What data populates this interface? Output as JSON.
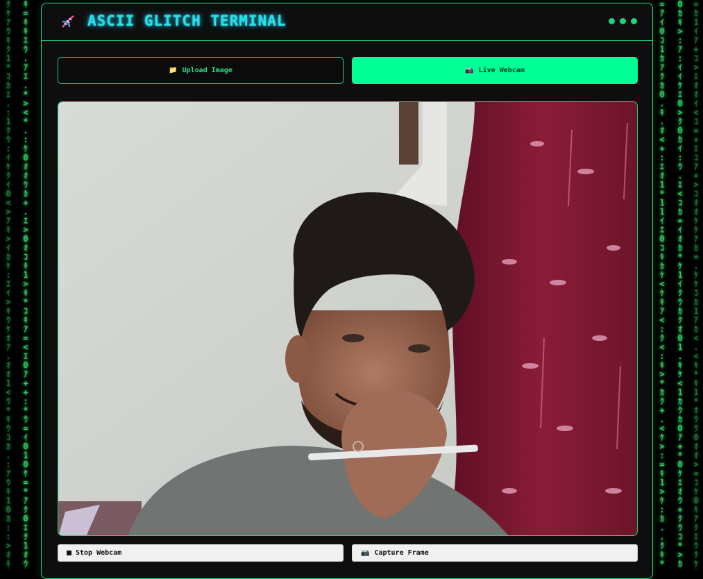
{
  "app": {
    "title": "ASCII GLITCH TERMINAL",
    "title_icon": "dna-icon",
    "window_dots": 3
  },
  "modes": {
    "upload": {
      "icon": "folder-icon",
      "label": "Upload Image"
    },
    "webcam": {
      "icon": "camera-icon",
      "label": "Live Webcam",
      "active": true
    }
  },
  "preview": {
    "content": "live-webcam-feed"
  },
  "controls": {
    "stop": {
      "icon": "stop-square-icon",
      "label": "Stop Webcam"
    },
    "capture": {
      "icon": "camera-icon",
      "label": "Capture Frame"
    }
  },
  "colors": {
    "accent_green": "#1ed97a",
    "active_button": "#00ff95",
    "title_cyan": "#21e6e0",
    "panel_bg": "#0e0e0e",
    "matrix_green": "#1fd65a"
  }
}
